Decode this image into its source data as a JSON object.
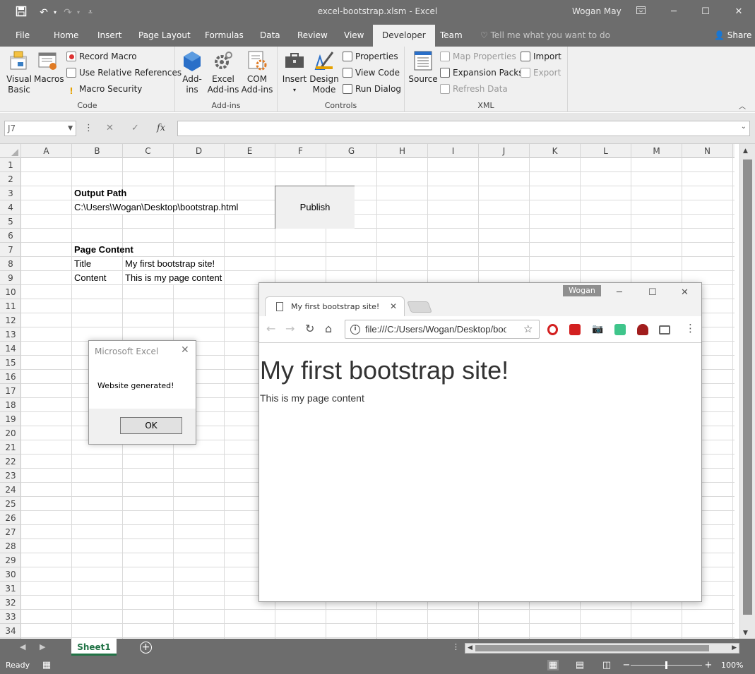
{
  "titlebar": {
    "title": "excel-bootstrap.xlsm - Excel",
    "user": "Wogan May"
  },
  "ribbon_tabs": [
    {
      "label": "File"
    },
    {
      "label": "Home"
    },
    {
      "label": "Insert"
    },
    {
      "label": "Page Layout"
    },
    {
      "label": "Formulas"
    },
    {
      "label": "Data"
    },
    {
      "label": "Review"
    },
    {
      "label": "View"
    },
    {
      "label": "Developer"
    },
    {
      "label": "Team"
    }
  ],
  "tellme": "Tell me what you want to do",
  "share": "Share",
  "ribbon": {
    "code": {
      "title": "Code",
      "visual_basic": "Visual Basic",
      "macros": "Macros",
      "record_macro": "Record Macro",
      "relative_refs": "Use Relative References",
      "macro_security": "Macro Security"
    },
    "addins": {
      "title": "Add-ins",
      "addins": "Add-ins",
      "excel_addins": "Excel Add-ins",
      "com_addins": "COM Add-ins"
    },
    "controls": {
      "title": "Controls",
      "insert": "Insert",
      "design_mode": "Design Mode",
      "properties": "Properties",
      "view_code": "View Code",
      "run_dialog": "Run Dialog"
    },
    "xml": {
      "title": "XML",
      "source": "Source",
      "map_properties": "Map Properties",
      "expansion_packs": "Expansion Packs",
      "refresh_data": "Refresh Data",
      "import": "Import",
      "export": "Export"
    }
  },
  "formula_bar": {
    "name_box": "J7",
    "fx": "fx",
    "formula": ""
  },
  "columns": [
    "A",
    "B",
    "C",
    "D",
    "E",
    "F",
    "G",
    "H",
    "I",
    "J",
    "K",
    "L",
    "M",
    "N"
  ],
  "rows": [
    "1",
    "2",
    "3",
    "4",
    "5",
    "6",
    "7",
    "8",
    "9",
    "10",
    "11",
    "12",
    "13",
    "14",
    "15",
    "16",
    "17",
    "18",
    "19",
    "20",
    "21",
    "22",
    "23",
    "24",
    "25",
    "26",
    "27",
    "28",
    "29",
    "30",
    "31",
    "32",
    "33",
    "34"
  ],
  "cells": {
    "B3": "Output Path",
    "B4": "C:\\Users\\Wogan\\Desktop\\bootstrap.html",
    "B7": "Page Content",
    "B8": "Title",
    "C8": "My first bootstrap site!",
    "B9": "Content",
    "C9": "This is my page content"
  },
  "publish_button": "Publish",
  "sheet_tabs": [
    {
      "label": "Sheet1",
      "active": true
    }
  ],
  "status": {
    "ready": "Ready",
    "zoom": "100%"
  },
  "msgbox": {
    "title": "Microsoft Excel",
    "message": "Website generated!",
    "ok": "OK"
  },
  "browser": {
    "profile": "Wogan",
    "tab_title": "My first bootstrap site!",
    "url": "file:///C:/Users/Wogan/Desktop/bootstrap.html",
    "heading": "My first bootstrap site!",
    "body": "This is my page content"
  },
  "colors": {
    "chrome_dark": "#6d6d6d",
    "ribbon_bg": "#f0f0f0",
    "excel_green": "#217346"
  }
}
